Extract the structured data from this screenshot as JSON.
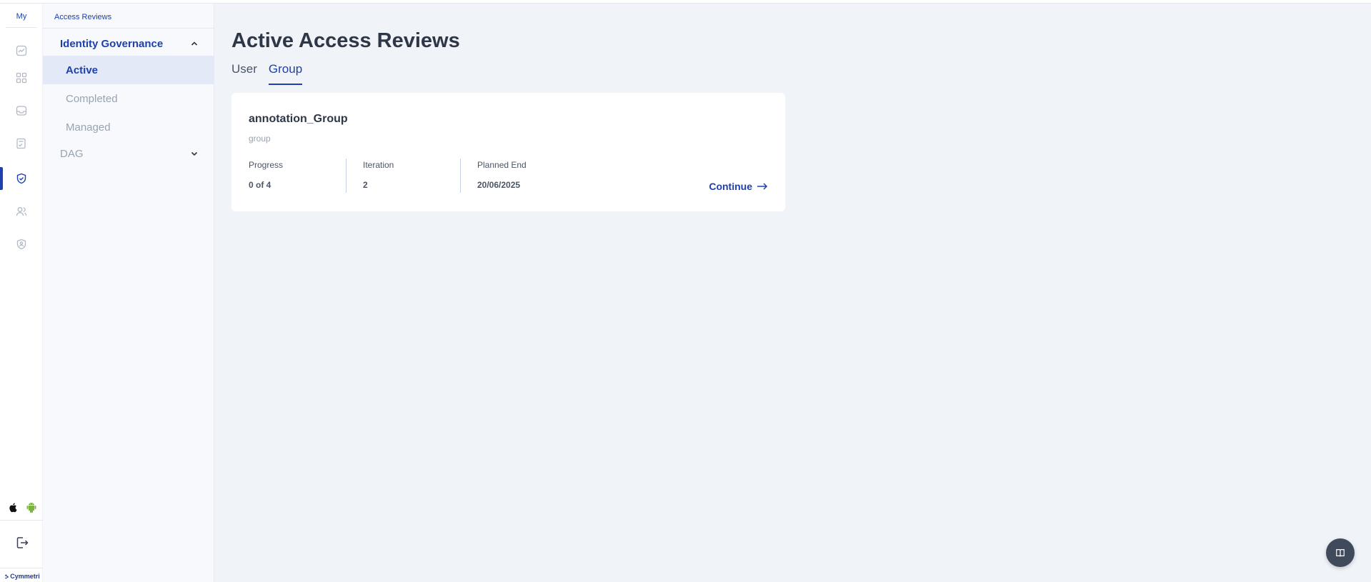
{
  "rail": {
    "brand": "My",
    "icons": [
      "chart-icon",
      "grid-icon",
      "inbox-icon",
      "checklist-icon",
      "shield-check-icon",
      "users-icon",
      "badge-icon"
    ],
    "logo_text": "Cymmetri"
  },
  "sidebar": {
    "breadcrumb": "Access Reviews",
    "group_label": "Identity Governance",
    "items": [
      {
        "label": "Active"
      },
      {
        "label": "Completed"
      },
      {
        "label": "Managed"
      }
    ],
    "dag_label": "DAG"
  },
  "main": {
    "title": "Active Access Reviews",
    "tabs": [
      {
        "label": "User"
      },
      {
        "label": "Group"
      }
    ]
  },
  "card": {
    "title": "annotation_Group",
    "subtitle": "group",
    "progress_label": "Progress",
    "progress_value": "0 of 4",
    "iteration_label": "Iteration",
    "iteration_value": "2",
    "planned_end_label": "Planned End",
    "planned_end_value": "20/06/2025",
    "continue_label": "Continue"
  },
  "colors": {
    "accent": "#1e40af",
    "background": "#f0f3f8",
    "fab": "#3f4a5a",
    "android": "#7cb342"
  }
}
